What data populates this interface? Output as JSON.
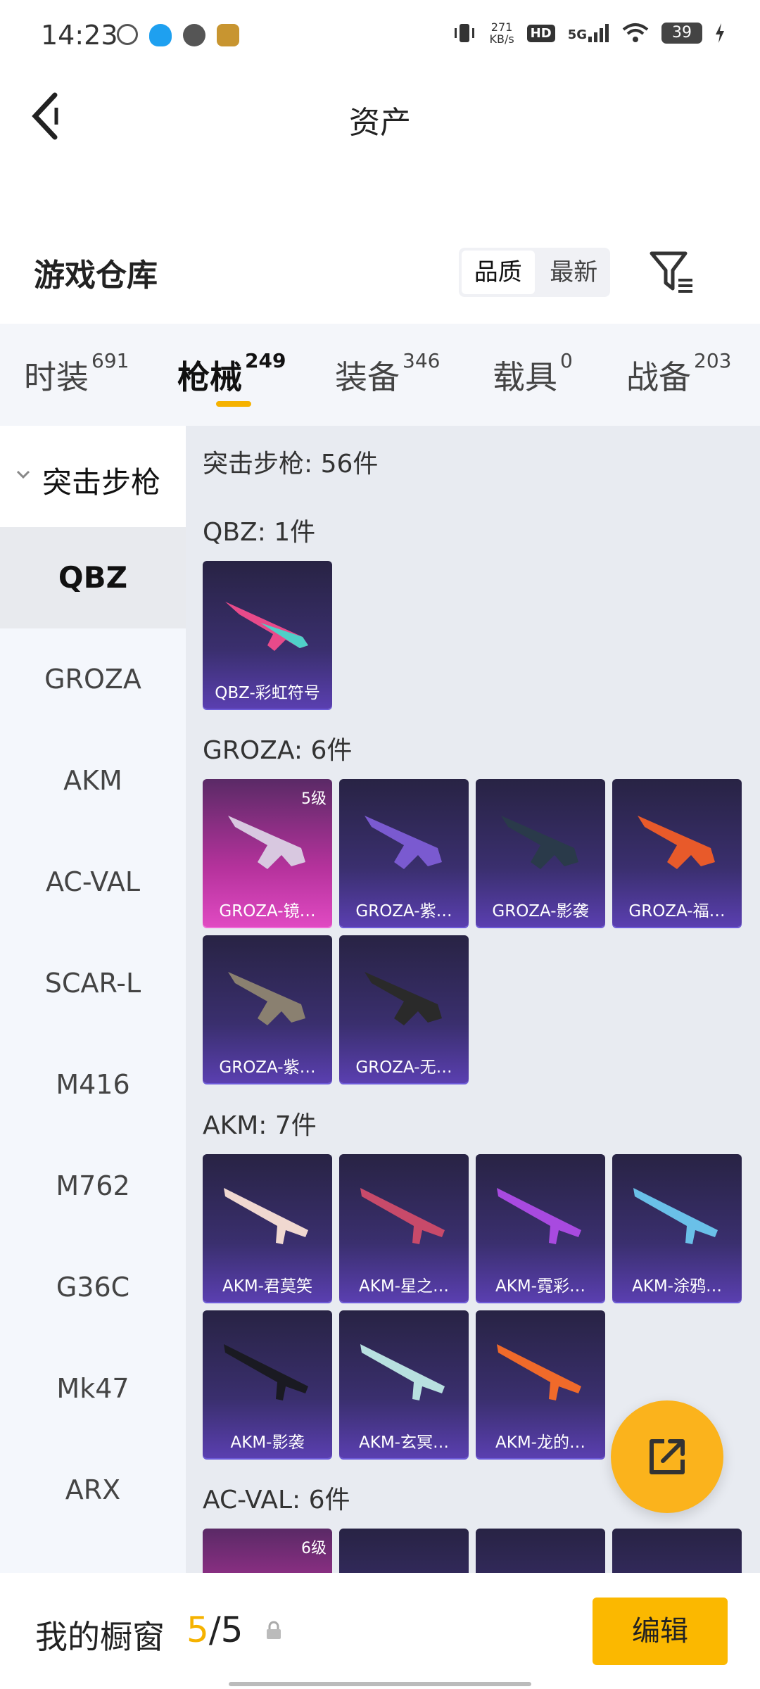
{
  "status_bar": {
    "time": "14:23",
    "net_speed_value": "271",
    "net_speed_unit": "KB/s",
    "hd": "HD",
    "signal": "5G",
    "battery": "39"
  },
  "header": {
    "title": "资产"
  },
  "warehouse": {
    "title": "游戏仓库",
    "sort_options": [
      "品质",
      "最新"
    ],
    "active_sort": "品质"
  },
  "categories": [
    {
      "label": "时装",
      "count": "691"
    },
    {
      "label": "枪械",
      "count": "249"
    },
    {
      "label": "装备",
      "count": "346"
    },
    {
      "label": "载具",
      "count": "0"
    },
    {
      "label": "战备",
      "count": "203"
    }
  ],
  "sidebar": {
    "group": "突击步枪",
    "items": [
      "QBZ",
      "GROZA",
      "AKM",
      "AC-VAL",
      "SCAR-L",
      "M416",
      "M762",
      "G36C",
      "Mk47",
      "ARX"
    ]
  },
  "content": {
    "summary": "突击步枪: 56件",
    "sections": [
      {
        "title": "QBZ: 1件",
        "items": [
          {
            "name": "QBZ-彩虹符号"
          }
        ]
      },
      {
        "title": "GROZA: 6件",
        "items": [
          {
            "name": "GROZA-镜…",
            "level": "5级"
          },
          {
            "name": "GROZA-紫…"
          },
          {
            "name": "GROZA-影袭"
          },
          {
            "name": "GROZA-福…"
          },
          {
            "name": "GROZA-紫…"
          },
          {
            "name": "GROZA-无…"
          }
        ]
      },
      {
        "title": "AKM: 7件",
        "items": [
          {
            "name": "AKM-君莫笑"
          },
          {
            "name": "AKM-星之…"
          },
          {
            "name": "AKM-霓彩…"
          },
          {
            "name": "AKM-涂鸦…"
          },
          {
            "name": "AKM-影袭"
          },
          {
            "name": "AKM-玄冥…"
          },
          {
            "name": "AKM-龙的…"
          }
        ]
      },
      {
        "title": "AC-VAL: 6件",
        "items": [
          {
            "level": "6级"
          }
        ]
      }
    ]
  },
  "bottom": {
    "label": "我的橱窗",
    "current": "5",
    "total": "/5",
    "edit": "编辑"
  },
  "colors": {
    "accent": "#fbb800",
    "card_bg": "#3a2f6e",
    "card_pink": "#b5329c"
  }
}
